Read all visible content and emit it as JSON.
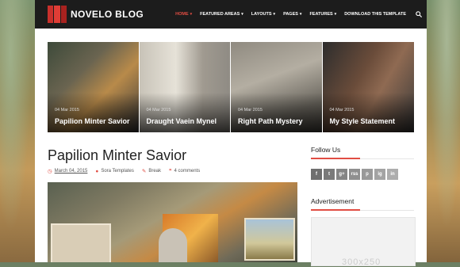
{
  "header": {
    "logo_text": "NOVELO BLOG",
    "nav": [
      {
        "label": "HOME",
        "active": true,
        "has_caret": true
      },
      {
        "label": "FEATURED AREAS",
        "active": false,
        "has_caret": true
      },
      {
        "label": "LAYOUTS",
        "active": false,
        "has_caret": true
      },
      {
        "label": "PAGES",
        "active": false,
        "has_caret": true
      },
      {
        "label": "FEATURES",
        "active": false,
        "has_caret": true
      },
      {
        "label": "DOWNLOAD THIS TEMPLATE",
        "active": false,
        "has_caret": false
      }
    ],
    "search_icon": "search-icon"
  },
  "featured": [
    {
      "date": "04 Mar 2015",
      "title": "Papilion Minter Savior"
    },
    {
      "date": "04 Mar 2015",
      "title": "Draught Vaein Mynel"
    },
    {
      "date": "04 Mar 2015",
      "title": "Right Path Mystery"
    },
    {
      "date": "04 Mar 2015",
      "title": "My Style Statement"
    }
  ],
  "post": {
    "title": "Papilion Minter Savior",
    "date": "March 04, 2015",
    "author": "Sora Templates",
    "category": "Break",
    "comments": "4 comments"
  },
  "sidebar": {
    "follow_heading": "Follow Us",
    "social": [
      {
        "label": "f",
        "icon": "facebook-icon",
        "color": "#6f6f6f"
      },
      {
        "label": "t",
        "icon": "twitter-icon",
        "color": "#7a7a7a"
      },
      {
        "label": "g+",
        "icon": "google-plus-icon",
        "color": "#858585"
      },
      {
        "label": "rss",
        "icon": "rss-icon",
        "color": "#8f8f8f"
      },
      {
        "label": "p",
        "icon": "pinterest-icon",
        "color": "#999999"
      },
      {
        "label": "ig",
        "icon": "instagram-icon",
        "color": "#a3a3a3"
      },
      {
        "label": "in",
        "icon": "linkedin-icon",
        "color": "#adadad"
      }
    ],
    "ad_heading": "Advertisement",
    "ad_text": "300x250"
  },
  "colors": {
    "accent": "#e14d43",
    "header_bg": "#1c1c1c"
  }
}
